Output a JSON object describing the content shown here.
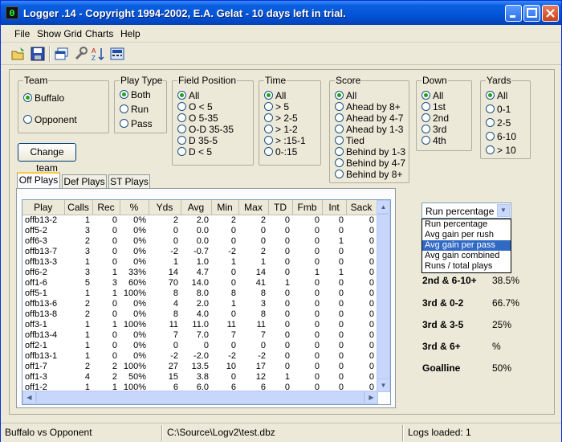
{
  "window": {
    "title": "Logger .14 - Copyright 1994-2002, E.A. Gelat - 10 days left in trial.",
    "app_icon_text": "0"
  },
  "menu": [
    "File",
    "Show Grid",
    "Charts",
    "Help"
  ],
  "toolbar": {
    "icons": [
      "open-icon",
      "save-icon",
      "window-icon",
      "wrench-icon",
      "sort-icon",
      "calculator-icon"
    ]
  },
  "team": {
    "title": "Team",
    "options": [
      "Buffalo",
      "Opponent"
    ],
    "selected": "Buffalo"
  },
  "play_type": {
    "title": "Play Type",
    "options": [
      "Both",
      "Run",
      "Pass"
    ],
    "selected": "Both"
  },
  "field_position": {
    "title": "Field Position",
    "options": [
      "All",
      "O < 5",
      "O 5-35",
      "O-D 35-35",
      "D 35-5",
      "D < 5"
    ],
    "selected": "All"
  },
  "time": {
    "title": "Time",
    "options": [
      "All",
      "> 5",
      "> 2-5",
      "> 1-2",
      "> :15-1",
      "0-:15"
    ],
    "selected": "All"
  },
  "score": {
    "title": "Score",
    "options": [
      "All",
      "Ahead by 8+",
      "Ahead by 4-7",
      "Ahead by 1-3",
      "Tied",
      "Behind by 1-3",
      "Behind by 4-7",
      "Behind by 8+"
    ],
    "selected": "All"
  },
  "down": {
    "title": "Down",
    "options": [
      "All",
      "1st",
      "2nd",
      "3rd",
      "4th"
    ],
    "selected": "All"
  },
  "yards": {
    "title": "Yards",
    "options": [
      "All",
      "0-1",
      "2-5",
      "6-10",
      "> 10"
    ],
    "selected": "All"
  },
  "change_team_label": "Change team",
  "tabs": [
    {
      "label": "Off Plays",
      "active": true
    },
    {
      "label": "Def Plays",
      "active": false
    },
    {
      "label": "ST Plays",
      "active": false
    }
  ],
  "grid": {
    "columns": [
      "Play",
      "Calls",
      "Rec",
      "%",
      "Yds",
      "Avg",
      "Min",
      "Max",
      "TD",
      "Fmb",
      "Int",
      "Sack"
    ],
    "rows": [
      [
        "offb13-2",
        "1",
        "0",
        "0%",
        "2",
        "2.0",
        "2",
        "2",
        "0",
        "0",
        "0",
        "0"
      ],
      [
        "off5-2",
        "3",
        "0",
        "0%",
        "0",
        "0.0",
        "0",
        "0",
        "0",
        "0",
        "0",
        "0"
      ],
      [
        "off6-3",
        "2",
        "0",
        "0%",
        "0",
        "0.0",
        "0",
        "0",
        "0",
        "0",
        "1",
        "0"
      ],
      [
        "offb13-7",
        "3",
        "0",
        "0%",
        "-2",
        "-0.7",
        "-2",
        "2",
        "0",
        "0",
        "0",
        "0"
      ],
      [
        "offb13-3",
        "1",
        "0",
        "0%",
        "1",
        "1.0",
        "1",
        "1",
        "0",
        "0",
        "0",
        "0"
      ],
      [
        "off6-2",
        "3",
        "1",
        "33%",
        "14",
        "4.7",
        "0",
        "14",
        "0",
        "1",
        "1",
        "0"
      ],
      [
        "off1-6",
        "5",
        "3",
        "60%",
        "70",
        "14.0",
        "0",
        "41",
        "1",
        "0",
        "0",
        "0"
      ],
      [
        "off5-1",
        "1",
        "1",
        "100%",
        "8",
        "8.0",
        "8",
        "8",
        "0",
        "0",
        "0",
        "0"
      ],
      [
        "offb13-6",
        "2",
        "0",
        "0%",
        "4",
        "2.0",
        "1",
        "3",
        "0",
        "0",
        "0",
        "0"
      ],
      [
        "offb13-8",
        "2",
        "0",
        "0%",
        "8",
        "4.0",
        "0",
        "8",
        "0",
        "0",
        "0",
        "0"
      ],
      [
        "off3-1",
        "1",
        "1",
        "100%",
        "11",
        "11.0",
        "11",
        "11",
        "0",
        "0",
        "0",
        "0"
      ],
      [
        "offb13-4",
        "1",
        "0",
        "0%",
        "7",
        "7.0",
        "7",
        "7",
        "0",
        "0",
        "0",
        "0"
      ],
      [
        "off2-1",
        "1",
        "0",
        "0%",
        "0",
        "0",
        "0",
        "0",
        "0",
        "0",
        "0",
        "0"
      ],
      [
        "offb13-1",
        "1",
        "0",
        "0%",
        "-2",
        "-2.0",
        "-2",
        "-2",
        "0",
        "0",
        "0",
        "0"
      ],
      [
        "off1-7",
        "2",
        "2",
        "100%",
        "27",
        "13.5",
        "10",
        "17",
        "0",
        "0",
        "0",
        "0"
      ],
      [
        "off1-3",
        "4",
        "2",
        "50%",
        "15",
        "3.8",
        "0",
        "12",
        "1",
        "0",
        "0",
        "0"
      ],
      [
        "off1-2",
        "1",
        "1",
        "100%",
        "6",
        "6.0",
        "6",
        "6",
        "0",
        "0",
        "0",
        "0"
      ]
    ]
  },
  "chart_select": {
    "value": "Run percentage",
    "options": [
      "Run percentage",
      "Avg gain per rush",
      "Avg gain per pass",
      "Avg gain combined",
      "Runs / total plays"
    ],
    "highlighted": "Avg gain per pass"
  },
  "stats": [
    {
      "label": "2nd & 6-10+",
      "value": "38.5%"
    },
    {
      "label": "3rd & 0-2",
      "value": "66.7%"
    },
    {
      "label": "3rd & 3-5",
      "value": "25%"
    },
    {
      "label": "3rd & 6+",
      "value": "%"
    },
    {
      "label": "Goalline",
      "value": "50%"
    }
  ],
  "status": {
    "matchup": "Buffalo vs Opponent",
    "file": "C:\\Source\\Logv2\\test.dbz",
    "logs": "Logs loaded: 1"
  }
}
